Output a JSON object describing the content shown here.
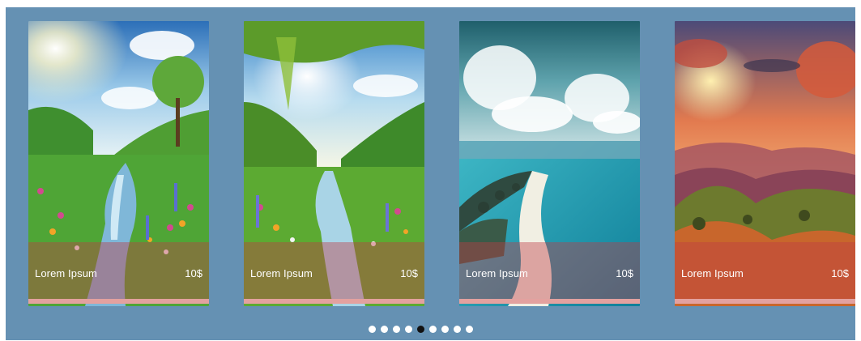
{
  "carousel": {
    "cards": [
      {
        "title": "Lorem Ipsum",
        "price": "10$",
        "image": "sunny-meadow-stream-image"
      },
      {
        "title": "Lorem Ipsum",
        "price": "10$",
        "image": "forest-valley-stream-image"
      },
      {
        "title": "Lorem Ipsum",
        "price": "10$",
        "image": "tropical-lagoon-image"
      },
      {
        "title": "Lorem Ipsum",
        "price": "10$",
        "image": "sunset-mountains-image"
      }
    ],
    "pagination": {
      "total_pages": 9,
      "active_page": 5
    }
  },
  "colors": {
    "background": "#6591b3",
    "overlay": "#be3c46",
    "card_bottom_bar": "#e3a19f",
    "active_dot": "#111111",
    "inactive_dot": "#ffffff"
  }
}
